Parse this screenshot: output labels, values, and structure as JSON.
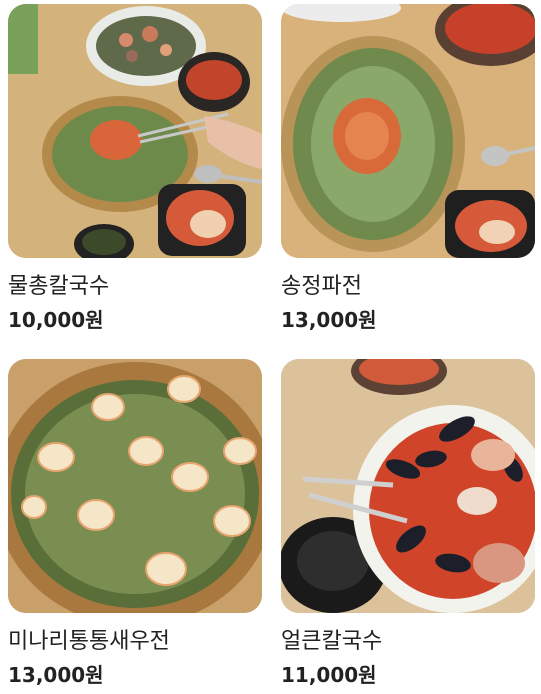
{
  "menu": [
    {
      "name": "물총칼국수",
      "price": "10,000원"
    },
    {
      "name": "송정파전",
      "price": "13,000원"
    },
    {
      "name": "미나리통통새우전",
      "price": "13,000원"
    },
    {
      "name": "얼큰칼국수",
      "price": "11,000원"
    }
  ]
}
